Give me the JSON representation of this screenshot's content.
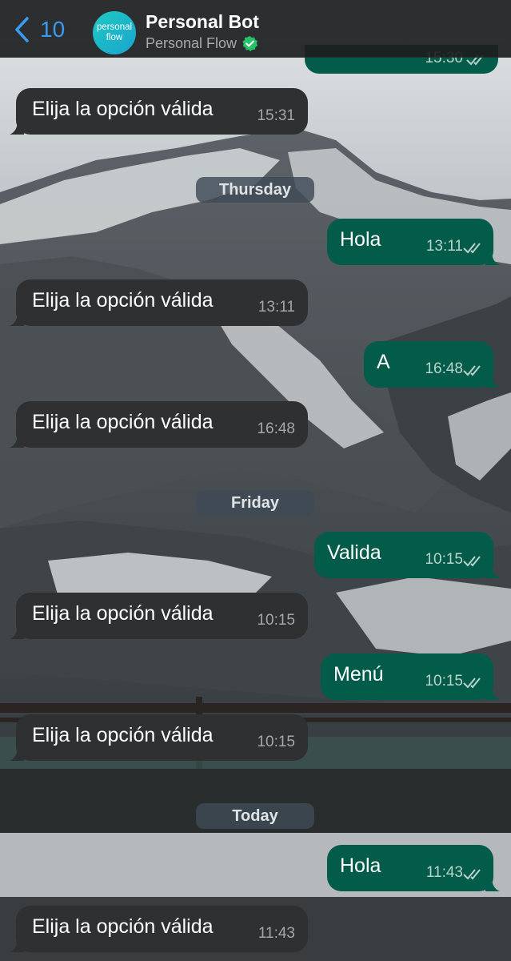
{
  "header": {
    "back_count": "10",
    "avatar_text_line1": "personal",
    "avatar_text_line2": "flow",
    "title": "Personal Bot",
    "subtitle": "Personal Flow"
  },
  "partial_message": {
    "time": "15:30"
  },
  "messages": [
    {
      "text": "Elija la opción válida",
      "time": "15:31"
    },
    {
      "date": "Thursday"
    },
    {
      "text": "Hola",
      "time": "13:11"
    },
    {
      "text": "Elija la opción válida",
      "time": "13:11"
    },
    {
      "text": "A",
      "time": "16:48"
    },
    {
      "text": "Elija la opción válida",
      "time": "16:48"
    },
    {
      "date": "Friday"
    },
    {
      "text": "Valida",
      "time": "10:15"
    },
    {
      "text": "Elija la opción válida",
      "time": "10:15"
    },
    {
      "text": "Menú",
      "time": "10:15"
    },
    {
      "text": "Elija la opción válida",
      "time": "10:15"
    },
    {
      "date": "Today"
    },
    {
      "text": "Hola",
      "time": "11:43"
    },
    {
      "text": "Elija la opción válida",
      "time": "11:43"
    }
  ],
  "colors": {
    "incoming_bubble": "#2e3032",
    "outgoing_bubble": "#035b49",
    "accent": "#3a9bf0",
    "verified": "#25c26a"
  },
  "icons": [
    "back-chevron-icon",
    "verified-badge-icon",
    "double-check-icon"
  ]
}
